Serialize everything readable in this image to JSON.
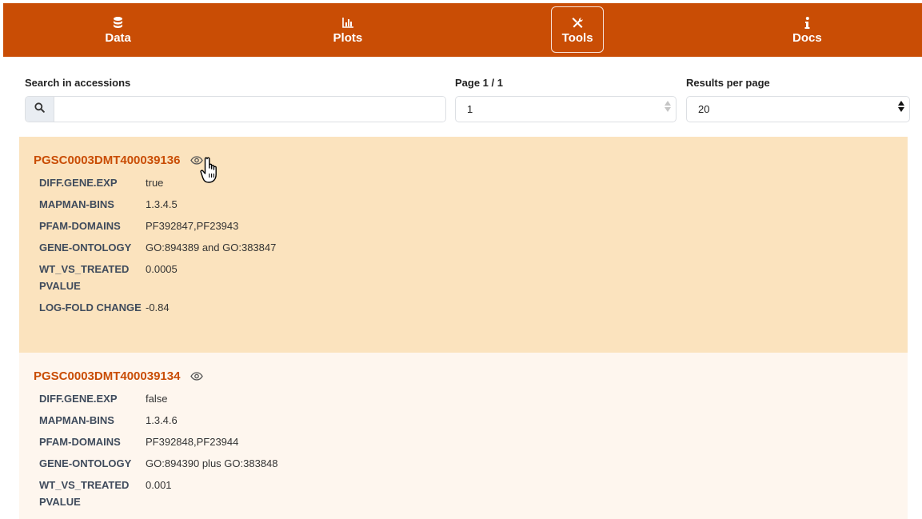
{
  "nav": {
    "items": [
      {
        "label": "Data",
        "icon": "database-icon"
      },
      {
        "label": "Plots",
        "icon": "bar-chart-icon"
      },
      {
        "label": "Tools",
        "icon": "tools-icon",
        "active": true
      },
      {
        "label": "Docs",
        "icon": "info-icon"
      }
    ]
  },
  "search": {
    "label": "Search in accessions",
    "value": "",
    "placeholder": ""
  },
  "pagination": {
    "label": "Page 1 / 1",
    "value": "1"
  },
  "results_per_page": {
    "label": "Results per page",
    "value": "20"
  },
  "colors": {
    "brand": "#c94d05",
    "card_highlight": "#fbe3be",
    "card_light": "#fef6ee"
  },
  "results": [
    {
      "accession": "PGSC0003DMT400039136",
      "fields": [
        {
          "key": "DIFF.GENE.EXP",
          "value": "true"
        },
        {
          "key": "MAPMAN-BINS",
          "value": "1.3.4.5"
        },
        {
          "key": "PFAM-DOMAINS",
          "value": "PF392847,PF23943"
        },
        {
          "key": "GENE-ONTOLOGY",
          "value": "GO:894389 and GO:383847"
        },
        {
          "key": "WT_VS_TREATED PVALUE",
          "value": "0.0005"
        },
        {
          "key": "LOG-FOLD CHANGE",
          "value": "-0.84"
        }
      ]
    },
    {
      "accession": "PGSC0003DMT400039134",
      "fields": [
        {
          "key": "DIFF.GENE.EXP",
          "value": "false"
        },
        {
          "key": "MAPMAN-BINS",
          "value": "1.3.4.6"
        },
        {
          "key": "PFAM-DOMAINS",
          "value": "PF392848,PF23944"
        },
        {
          "key": "GENE-ONTOLOGY",
          "value": "GO:894390 plus GO:383848"
        },
        {
          "key": "WT_VS_TREATED PVALUE",
          "value": "0.001"
        }
      ]
    }
  ]
}
